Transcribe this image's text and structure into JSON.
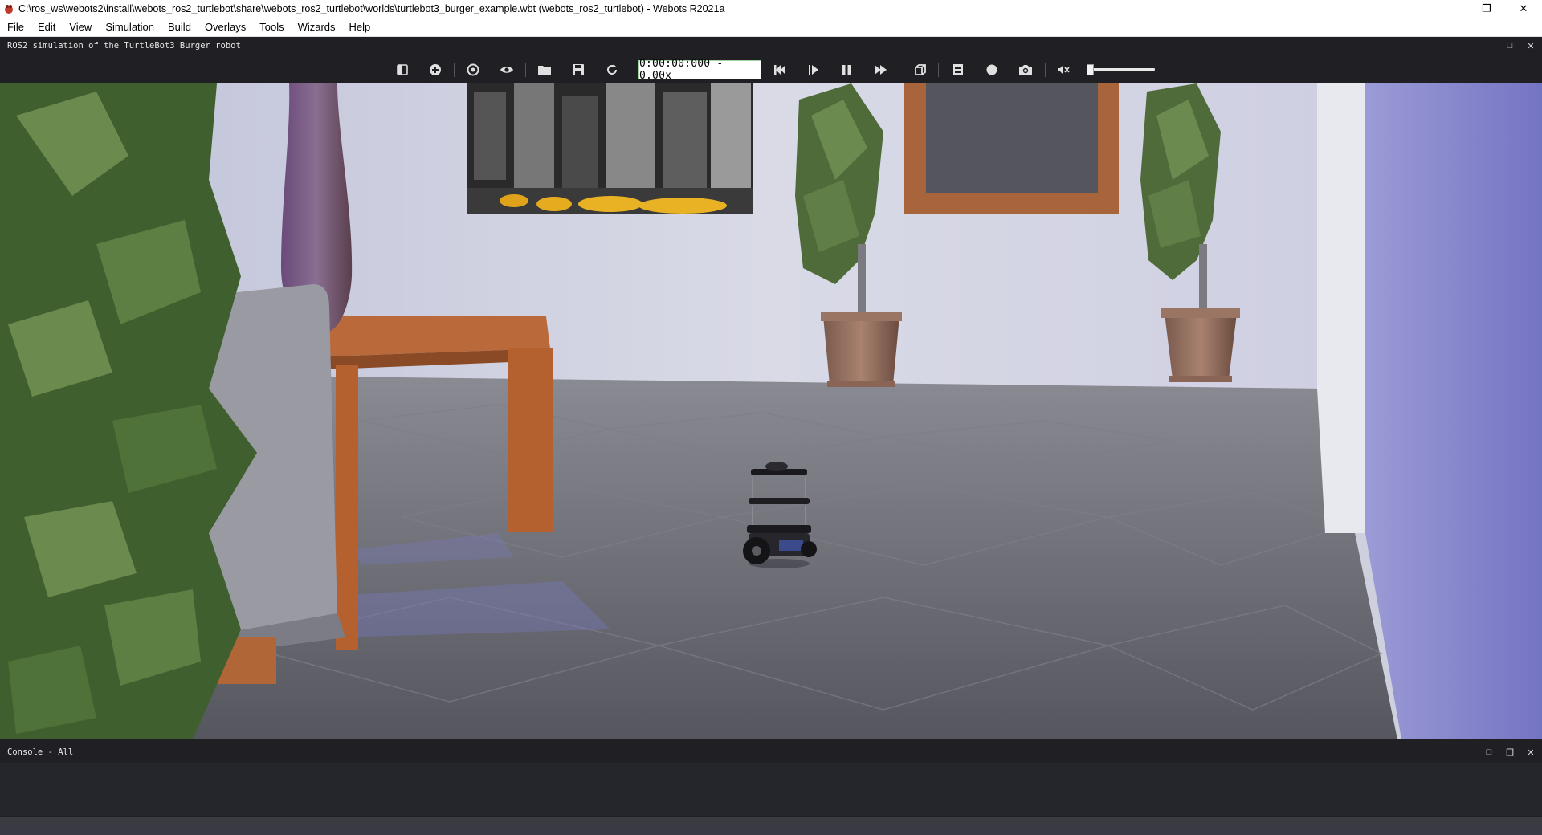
{
  "window": {
    "title": "C:\\ros_ws\\webots2\\install\\webots_ros2_turtlebot\\share\\webots_ros2_turtlebot\\worlds\\turtlebot3_burger_example.wbt (webots_ros2_turtlebot) - Webots R2021a",
    "minimize_glyph": "—",
    "restore_glyph": "❐",
    "close_glyph": "✕"
  },
  "menu": [
    "File",
    "Edit",
    "View",
    "Simulation",
    "Build",
    "Overlays",
    "Tools",
    "Wizards",
    "Help"
  ],
  "view": {
    "dock_title": "ROS2 simulation of the TurtleBot3 Burger robot",
    "maximize_glyph": "□",
    "close_glyph": "✕"
  },
  "toolbar": {
    "time_text": "0:00:00:000  -  0.00x",
    "speed_level": 0.0,
    "icons": [
      "hide-scene-tree-icon",
      "add-node-icon",
      "view-point-icon",
      "visibility-icon",
      "open-world-icon",
      "save-world-icon",
      "reload-world-icon",
      "reset-simulation-icon",
      "step-icon",
      "pause-icon",
      "fast-forward-icon",
      "rendering-icon",
      "record-movie-icon",
      "record-animation-icon",
      "screenshot-icon",
      "mute-icon"
    ]
  },
  "console": {
    "dock_title": "Console - All",
    "maximize_glyph": "□",
    "undock_glyph": "❐",
    "close_glyph": "✕"
  },
  "colors": {
    "toolbar_bg": "#1f1f24",
    "accent_display_border": "#9fd39f",
    "wall": "#cdd0de",
    "floor": "#6f7079",
    "wood": "#b35e2b",
    "right_wall": "#8c8cd0"
  }
}
